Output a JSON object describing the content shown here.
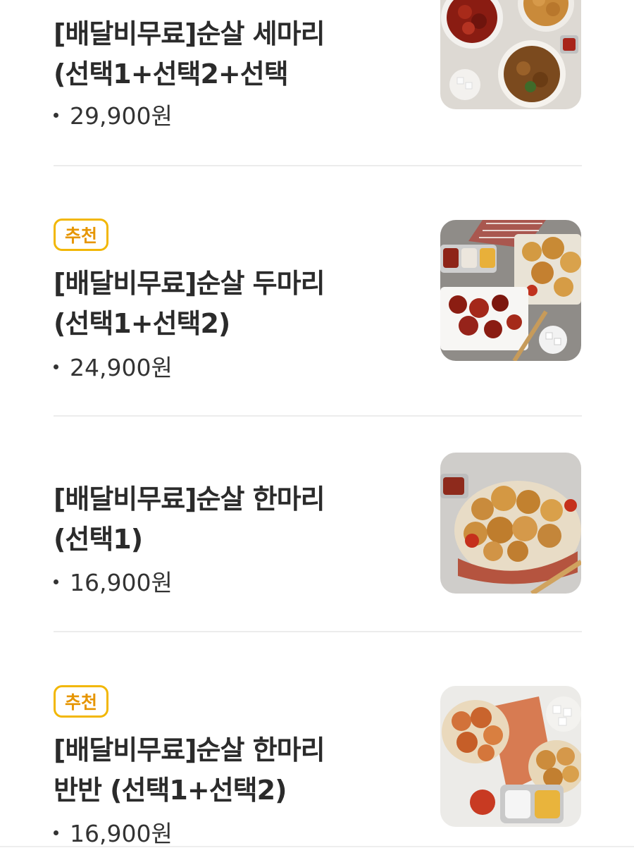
{
  "menu": {
    "items": [
      {
        "badge": "",
        "name_line1": "[배달비무료]순살 세마리",
        "name_line2": "(선택1+선택2+선택",
        "price": "29,900원",
        "image": "chicken-three-plates"
      },
      {
        "badge": "추천",
        "name_line1": "[배달비무료]순살 두마리",
        "name_line2": "(선택1+선택2)",
        "price": "24,900원",
        "image": "chicken-two-plates"
      },
      {
        "badge": "",
        "name_line1": "[배달비무료]순살 한마리",
        "name_line2": "(선택1)",
        "price": "16,900원",
        "image": "chicken-basket"
      },
      {
        "badge": "추천",
        "name_line1": "[배달비무료]순살 한마리",
        "name_line2": "반반 (선택1+선택2)",
        "price": "16,900원",
        "image": "chicken-half-half"
      }
    ]
  },
  "colors": {
    "badge_border": "#f2b705",
    "badge_text": "#e69500",
    "divider": "#ececec"
  }
}
